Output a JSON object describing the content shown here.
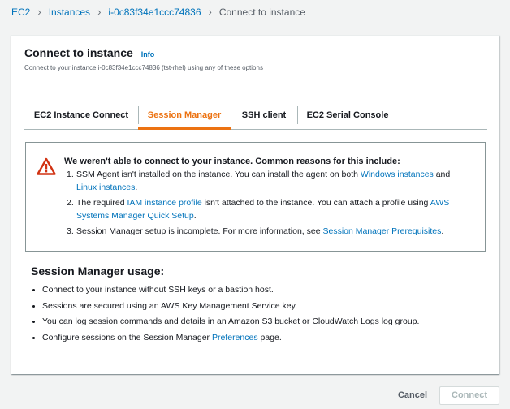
{
  "breadcrumb": {
    "items": [
      "EC2",
      "Instances",
      "i-0c83f34e1ccc74836"
    ],
    "current": "Connect to instance"
  },
  "panel": {
    "title": "Connect to instance",
    "info_label": "Info",
    "subtitle": "Connect to your instance i-0c83f34e1ccc74836 (tst-rhel) using any of these options"
  },
  "tabs": [
    {
      "label": "EC2 Instance Connect",
      "active": false
    },
    {
      "label": "Session Manager",
      "active": true
    },
    {
      "label": "SSH client",
      "active": false
    },
    {
      "label": "EC2 Serial Console",
      "active": false
    }
  ],
  "alert": {
    "title": "We weren't able to connect to your instance. Common reasons for this include:",
    "items": [
      {
        "num": "1.",
        "p1": "SSM Agent isn't installed on the instance. You can install the agent on both ",
        "link1": "Windows instances",
        "p2": " and ",
        "link2": "Linux instances",
        "p3": "."
      },
      {
        "num": "2.",
        "p1": "The required ",
        "link1": "IAM instance profile",
        "p2": " isn't attached to the instance. You can attach a profile using ",
        "link2": "AWS Systems Manager Quick Setup",
        "p3": "."
      },
      {
        "num": "3.",
        "p1": "Session Manager setup is incomplete. For more information, see ",
        "link1": "Session Manager Prerequisites",
        "p2": "."
      }
    ],
    "icon": "warning-triangle-icon",
    "color": "#d13212"
  },
  "usage": {
    "title": "Session Manager usage:",
    "items": [
      {
        "text": "Connect to your instance without SSH keys or a bastion host."
      },
      {
        "text": "Sessions are secured using an AWS Key Management Service key."
      },
      {
        "text": "You can log session commands and details in an Amazon S3 bucket or CloudWatch Logs log group."
      },
      {
        "p1": "Configure sessions on the Session Manager ",
        "link": "Preferences",
        "p2": " page."
      }
    ]
  },
  "footer": {
    "cancel_label": "Cancel",
    "connect_label": "Connect"
  },
  "colors": {
    "link": "#0073bb",
    "accent": "#ec7211",
    "error": "#d13212",
    "background": "#f2f3f3"
  }
}
